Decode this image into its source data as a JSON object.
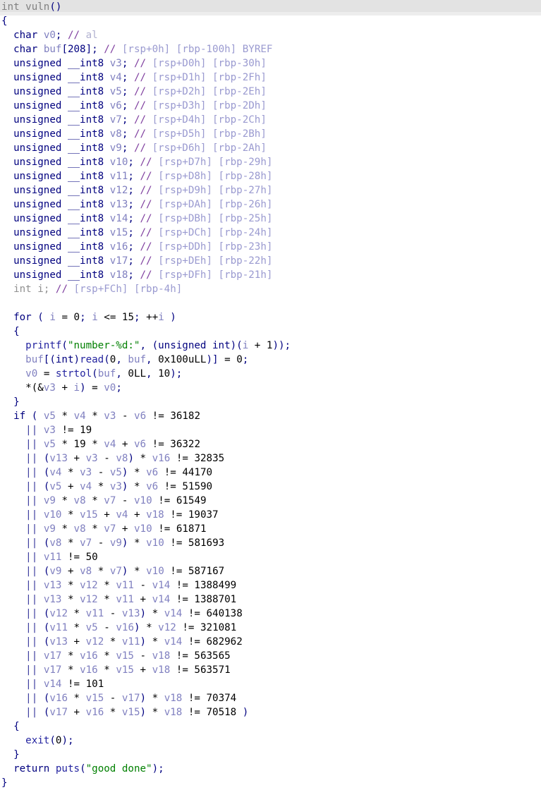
{
  "app": {
    "view_name": "IDA Pseudocode View",
    "window_title": "int vuln()"
  },
  "editor": {
    "current_line_index": 0,
    "font_size_px": 14,
    "line_height_px": 20,
    "background_color": "#ffffff",
    "current_line_highlight_color": "#e3e3e3"
  },
  "colors": {
    "keyword": "#00007f",
    "function": "#2424a0",
    "variable": "#8080c0",
    "number": "#000000",
    "string": "#008000",
    "comment": "#7f3f9f",
    "comment_location": "#9a9ad0",
    "dimmed": "#909090",
    "punctuation": "#000080"
  },
  "function_header": {
    "return_type": "int",
    "name": "vuln",
    "signature": "int vuln()"
  },
  "declarations": [
    {
      "type": "char",
      "name": "v0",
      "array": "",
      "comment": "al",
      "locations": []
    },
    {
      "type": "char",
      "name": "buf",
      "array": "[208]",
      "comment": "",
      "locations": [
        "[rsp+0h]",
        "[rbp-100h]"
      ],
      "extra": "BYREF"
    },
    {
      "type": "unsigned __int8",
      "name": "v3",
      "array": "",
      "comment": "",
      "locations": [
        "[rsp+D0h]",
        "[rbp-30h]"
      ]
    },
    {
      "type": "unsigned __int8",
      "name": "v4",
      "array": "",
      "comment": "",
      "locations": [
        "[rsp+D1h]",
        "[rbp-2Fh]"
      ]
    },
    {
      "type": "unsigned __int8",
      "name": "v5",
      "array": "",
      "comment": "",
      "locations": [
        "[rsp+D2h]",
        "[rbp-2Eh]"
      ]
    },
    {
      "type": "unsigned __int8",
      "name": "v6",
      "array": "",
      "comment": "",
      "locations": [
        "[rsp+D3h]",
        "[rbp-2Dh]"
      ]
    },
    {
      "type": "unsigned __int8",
      "name": "v7",
      "array": "",
      "comment": "",
      "locations": [
        "[rsp+D4h]",
        "[rbp-2Ch]"
      ]
    },
    {
      "type": "unsigned __int8",
      "name": "v8",
      "array": "",
      "comment": "",
      "locations": [
        "[rsp+D5h]",
        "[rbp-2Bh]"
      ]
    },
    {
      "type": "unsigned __int8",
      "name": "v9",
      "array": "",
      "comment": "",
      "locations": [
        "[rsp+D6h]",
        "[rbp-2Ah]"
      ]
    },
    {
      "type": "unsigned __int8",
      "name": "v10",
      "array": "",
      "comment": "",
      "locations": [
        "[rsp+D7h]",
        "[rbp-29h]"
      ]
    },
    {
      "type": "unsigned __int8",
      "name": "v11",
      "array": "",
      "comment": "",
      "locations": [
        "[rsp+D8h]",
        "[rbp-28h]"
      ]
    },
    {
      "type": "unsigned __int8",
      "name": "v12",
      "array": "",
      "comment": "",
      "locations": [
        "[rsp+D9h]",
        "[rbp-27h]"
      ]
    },
    {
      "type": "unsigned __int8",
      "name": "v13",
      "array": "",
      "comment": "",
      "locations": [
        "[rsp+DAh]",
        "[rbp-26h]"
      ]
    },
    {
      "type": "unsigned __int8",
      "name": "v14",
      "array": "",
      "comment": "",
      "locations": [
        "[rsp+DBh]",
        "[rbp-25h]"
      ]
    },
    {
      "type": "unsigned __int8",
      "name": "v15",
      "array": "",
      "comment": "",
      "locations": [
        "[rsp+DCh]",
        "[rbp-24h]"
      ]
    },
    {
      "type": "unsigned __int8",
      "name": "v16",
      "array": "",
      "comment": "",
      "locations": [
        "[rsp+DDh]",
        "[rbp-23h]"
      ]
    },
    {
      "type": "unsigned __int8",
      "name": "v17",
      "array": "",
      "comment": "",
      "locations": [
        "[rsp+DEh]",
        "[rbp-22h]"
      ]
    },
    {
      "type": "unsigned __int8",
      "name": "v18",
      "array": "",
      "comment": "",
      "locations": [
        "[rsp+DFh]",
        "[rbp-21h]"
      ]
    },
    {
      "type": "int",
      "name": "i",
      "array": "",
      "comment": "",
      "locations": [
        "[rsp+FCh]",
        "[rbp-4h]"
      ],
      "dimmed": true
    }
  ],
  "loop": {
    "header": "for ( i = 0; i <= 15; ++i )",
    "init": "i = 0",
    "condition": "i <= 15",
    "increment": "++i",
    "body": [
      "printf(\"number-%d:\", (unsigned int)(i + 1));",
      "buf[(int)read(0, buf, 0x100uLL)] = 0;",
      "v0 = strtol(buf, 0LL, 10);",
      "*(&v3 + i) = v0;"
    ],
    "printf_format": "number-%d:",
    "read_size": "0x100uLL",
    "strtol_base": "10"
  },
  "conditions": [
    {
      "expr": "v5 * v4 * v3 - v6",
      "op": "!=",
      "value": "36182"
    },
    {
      "expr": "v3",
      "op": "!=",
      "value": "19"
    },
    {
      "expr": "v5 * 19 * v4 + v6",
      "op": "!=",
      "value": "36322"
    },
    {
      "expr": "(v13 + v3 - v8) * v16",
      "op": "!=",
      "value": "32835"
    },
    {
      "expr": "(v4 * v3 - v5) * v6",
      "op": "!=",
      "value": "44170"
    },
    {
      "expr": "(v5 + v4 * v3) * v6",
      "op": "!=",
      "value": "51590"
    },
    {
      "expr": "v9 * v8 * v7 - v10",
      "op": "!=",
      "value": "61549"
    },
    {
      "expr": "v10 * v15 + v4 + v18",
      "op": "!=",
      "value": "19037"
    },
    {
      "expr": "v9 * v8 * v7 + v10",
      "op": "!=",
      "value": "61871"
    },
    {
      "expr": "(v8 * v7 - v9) * v10",
      "op": "!=",
      "value": "581693"
    },
    {
      "expr": "v11",
      "op": "!=",
      "value": "50"
    },
    {
      "expr": "(v9 + v8 * v7) * v10",
      "op": "!=",
      "value": "587167"
    },
    {
      "expr": "v13 * v12 * v11 - v14",
      "op": "!=",
      "value": "1388499"
    },
    {
      "expr": "v13 * v12 * v11 + v14",
      "op": "!=",
      "value": "1388701"
    },
    {
      "expr": "(v12 * v11 - v13) * v14",
      "op": "!=",
      "value": "640138"
    },
    {
      "expr": "(v11 * v5 - v16) * v12",
      "op": "!=",
      "value": "321081"
    },
    {
      "expr": "(v13 + v12 * v11) * v14",
      "op": "!=",
      "value": "682962"
    },
    {
      "expr": "v17 * v16 * v15 - v18",
      "op": "!=",
      "value": "563565"
    },
    {
      "expr": "v17 * v16 * v15 + v18",
      "op": "!=",
      "value": "563571"
    },
    {
      "expr": "v14",
      "op": "!=",
      "value": "101"
    },
    {
      "expr": "(v16 * v15 - v17) * v18",
      "op": "!=",
      "value": "70374"
    },
    {
      "expr": "(v17 + v16 * v15) * v18",
      "op": "!=",
      "value": "70518"
    }
  ],
  "if_body": {
    "call": "exit(0);",
    "exit_code": "0"
  },
  "return_statement": {
    "text": "return puts(\"good done\");",
    "function": "puts",
    "string": "good done"
  },
  "text": {
    "kw_char": "char",
    "kw_unsigned_int8": "unsigned __int8",
    "kw_int": "int",
    "kw_if": "if",
    "kw_for": "for",
    "kw_return": "return",
    "comment_marker": "//",
    "or_operator": "||",
    "open_brace": "{",
    "close_brace": "}"
  }
}
